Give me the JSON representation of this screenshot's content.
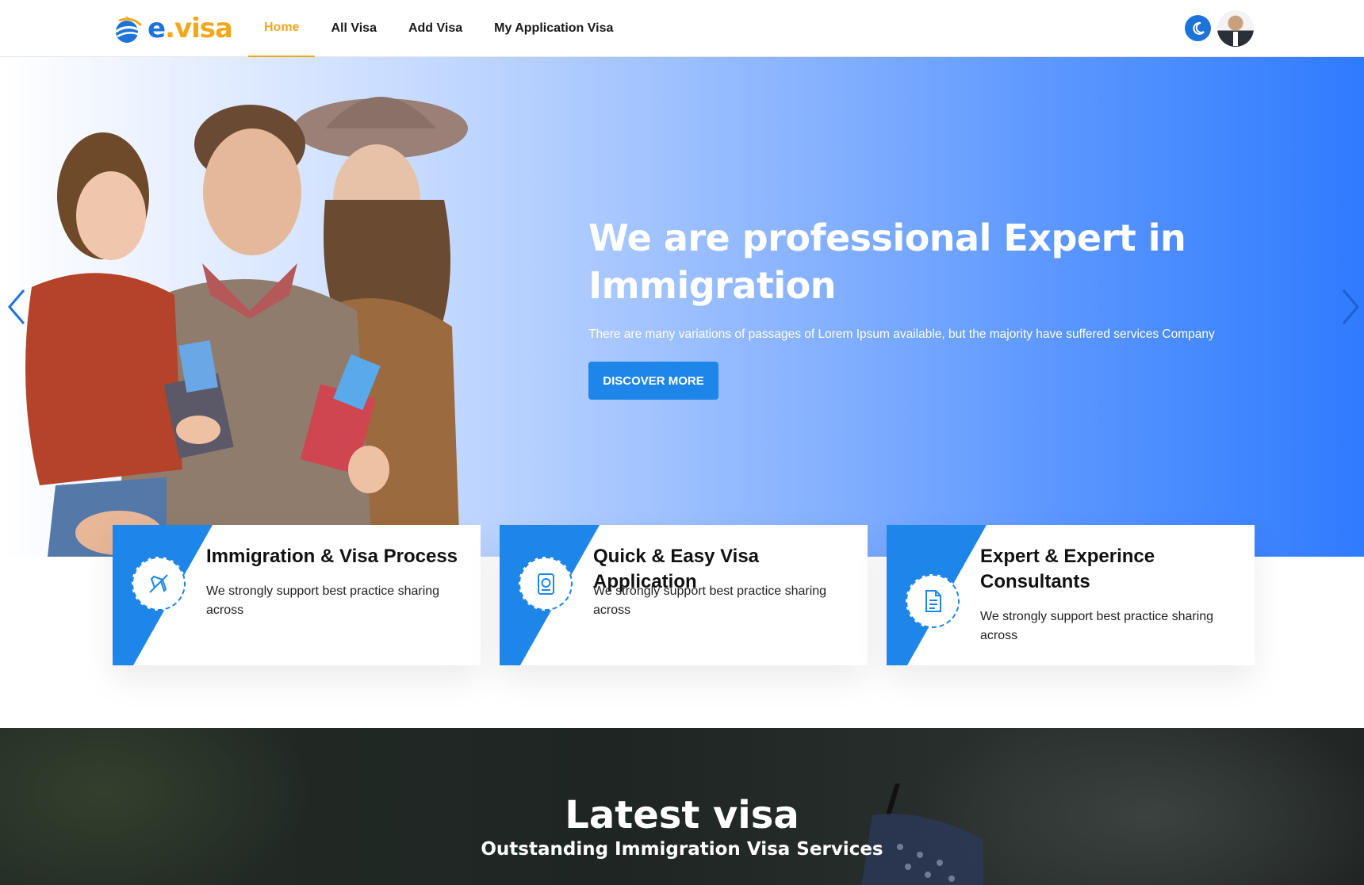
{
  "brand": {
    "logo_e": "e",
    "logo_dot": ".",
    "logo_rest": "visa",
    "primary": "#1e73d8",
    "accent": "#f2a81d"
  },
  "nav": {
    "items": [
      {
        "label": "Home",
        "active": true
      },
      {
        "label": "All Visa"
      },
      {
        "label": "Add Visa"
      },
      {
        "label": "My Application Visa"
      }
    ],
    "theme_icon": "moon-icon",
    "avatar_icon": "user-avatar"
  },
  "hero": {
    "title": "We are professional Expert in Immigration",
    "subtitle": "There are many variations of passages of Lorem Ipsum available, but the majority have suffered services Company",
    "cta": "DISCOVER MORE",
    "prev_icon": "chevron-left-icon",
    "next_icon": "chevron-right-icon"
  },
  "features": [
    {
      "icon": "airplane-icon",
      "title": "Immigration & Visa Process",
      "text": "We strongly support best practice sharing across"
    },
    {
      "icon": "passport-icon",
      "title": "Quick & Easy Visa Application",
      "text": "We strongly support best practice sharing across"
    },
    {
      "icon": "document-icon",
      "title": "Expert & Experince Consultants",
      "text": "We strongly support best practice sharing across"
    }
  ],
  "latest": {
    "title": "Latest visa",
    "subtitle": "Outstanding Immigration Visa Services"
  }
}
